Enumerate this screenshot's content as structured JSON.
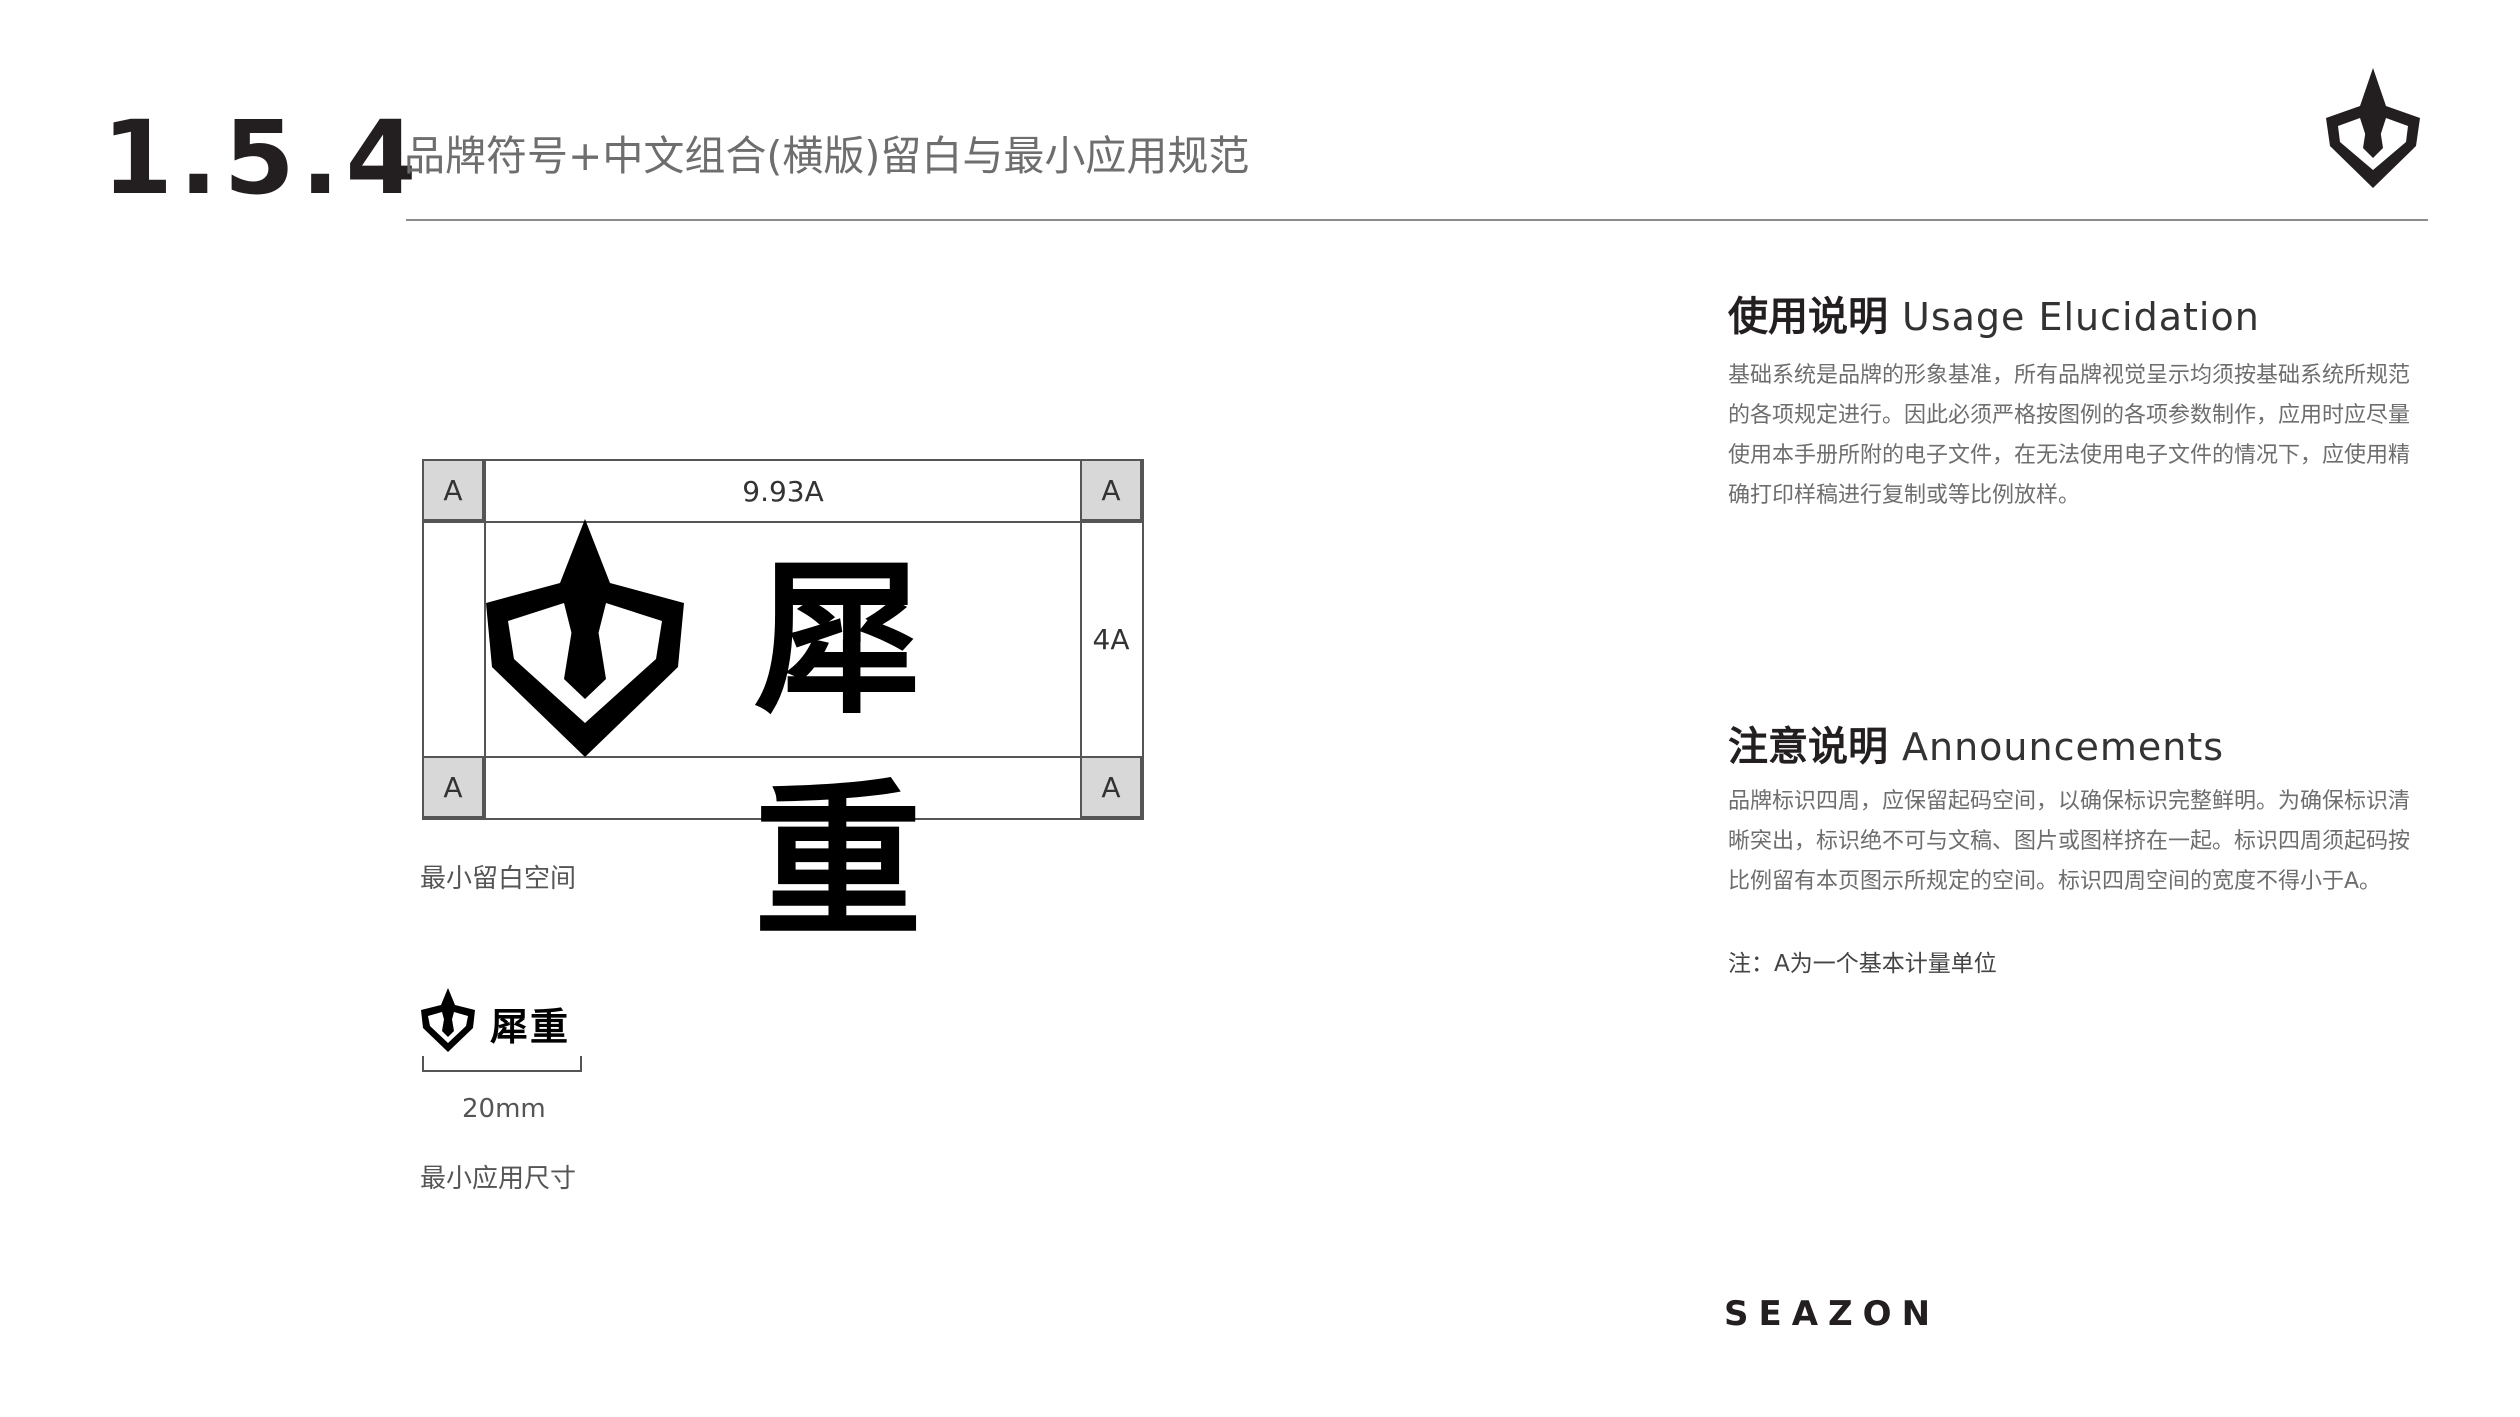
{
  "header": {
    "section_number": "1.5.4",
    "title": "品牌符号+中文组合(横版)留白与最小应用规范"
  },
  "diagram": {
    "corner_label": "A",
    "width_label": "9.93A",
    "height_label": "4A",
    "logo_text": "犀重",
    "caption": "最小留白空间"
  },
  "minimum_size": {
    "logo_text": "犀重",
    "size": "20mm",
    "caption": "最小应用尺寸"
  },
  "usage": {
    "title": "使用说明",
    "title_en": "Usage Elucidation",
    "body": "基础系统是品牌的形象基准，所有品牌视觉呈示均须按基础系统所规范的各项规定进行。因此必须严格按图例的各项参数制作，应用时应尽量使用本手册所附的电子文件，在无法使用电子文件的情况下，应使用精确打印样稿进行复制或等比例放样。"
  },
  "announcements": {
    "title": "注意说明",
    "title_en": "Announcements",
    "body": "品牌标识四周，应保留起码空间，以确保标识完整鲜明。为确保标识清晰突出，标识绝不可与文稿、图片或图样挤在一起。标识四周须起码按比例留有本页图示所规定的空间。标识四周空间的宽度不得小于A。",
    "note": "注：A为一个基本计量单位"
  },
  "footer": {
    "brand": "SEAZON"
  },
  "colors": {
    "ink": "#231f20",
    "muted": "#6e6e6e",
    "corner_fill": "#d8d8d8"
  }
}
